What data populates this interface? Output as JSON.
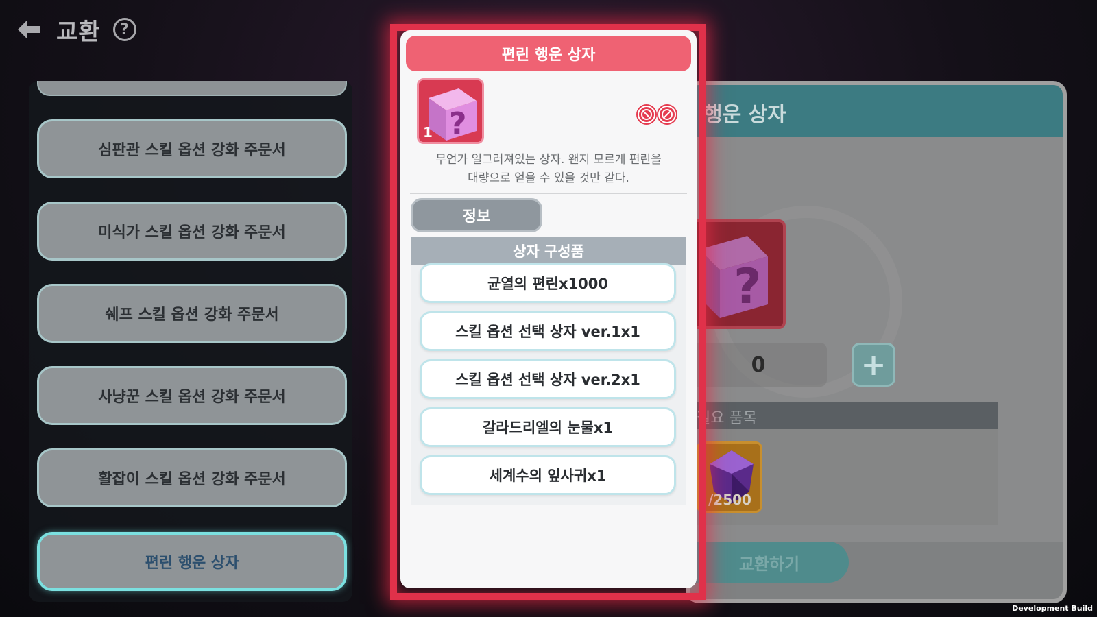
{
  "header": {
    "title": "교환",
    "help_icon": "?"
  },
  "sidebar": {
    "items": [
      {
        "label": "심판관 스킬 옵션 강화 주문서",
        "selected": false
      },
      {
        "label": "미식가 스킬 옵션 강화 주문서",
        "selected": false
      },
      {
        "label": "쉐프 스킬 옵션 강화 주문서",
        "selected": false
      },
      {
        "label": "사냥꾼 스킬 옵션 강화 주문서",
        "selected": false
      },
      {
        "label": "활잡이 스킬 옵션 강화 주문서",
        "selected": false
      },
      {
        "label": "편린 행운 상자",
        "selected": true
      }
    ]
  },
  "detail": {
    "title_visible": "행운 상자",
    "quantity": "0",
    "plus": "+",
    "required_label": "필요 품목",
    "required_count": "/2500",
    "exchange_label": "교환하기"
  },
  "popup": {
    "title": "편린 행운 상자",
    "item_count": "1",
    "description_line1": "무언가 일그러져있는 상자. 왠지 모르게 편린을",
    "description_line2": "대량으로 얻을 수 있을 것만 같다.",
    "info_tab": "정보",
    "contents_header": "상자 구성품",
    "contents": [
      "균열의 편린x1000",
      "스킬 옵션 선택 상자 ver.1x1",
      "스킬 옵션 선택 상자 ver.2x1",
      "갈라드리엘의 눈물x1",
      "세계수의 잎사귀x1"
    ],
    "colors": {
      "accent": "#ef6273",
      "glow": "#e0314a"
    }
  },
  "footer": {
    "build_label": "Development Build"
  }
}
